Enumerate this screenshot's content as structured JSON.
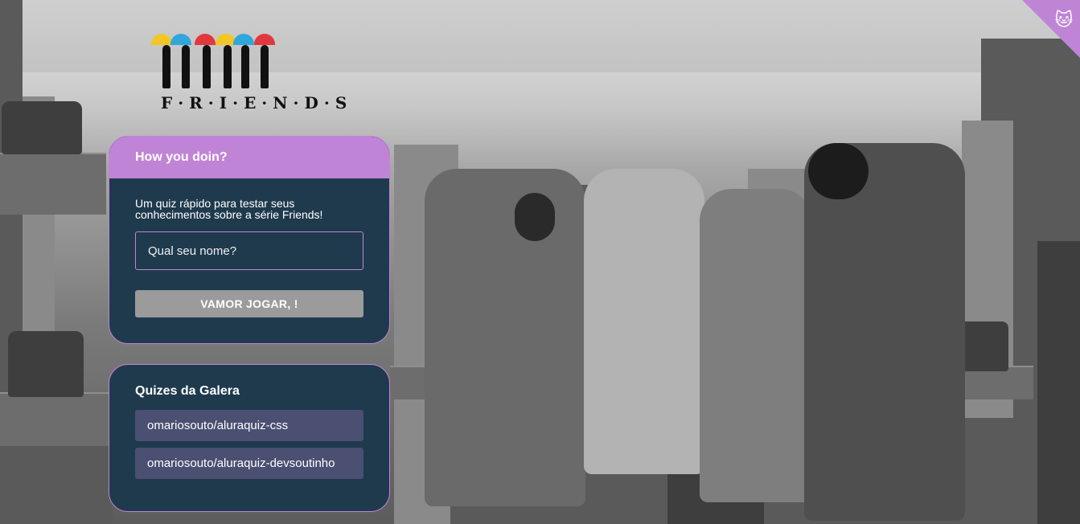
{
  "logo": {
    "text": "F·R·I·E·N·D·S"
  },
  "main_card": {
    "title": "How you doin?",
    "description": "Um quiz rápido para testar seus conhecimentos sobre a série Friends!",
    "name_placeholder": "Qual seu nome?",
    "play_label": "VAMOR JOGAR, !"
  },
  "quizzes_card": {
    "title": "Quizes da Galera",
    "links": [
      {
        "label": "omariosouto/aluraquiz-css"
      },
      {
        "label": "omariosouto/aluraquiz-devsoutinho"
      }
    ]
  },
  "colors": {
    "primary": "#c084d6",
    "card_bg": "#1f3a4d",
    "button_disabled": "#9b9b9b",
    "link_bg": "#4b4f71"
  },
  "icons": {
    "corner": "github-cat-icon"
  }
}
